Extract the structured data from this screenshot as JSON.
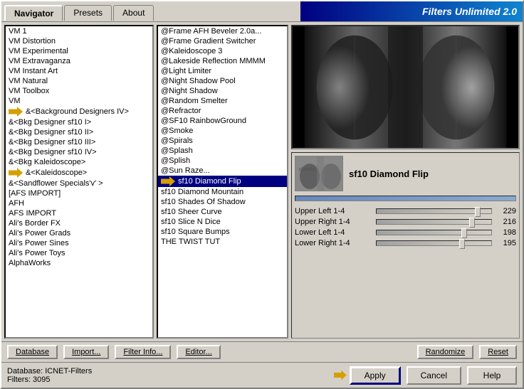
{
  "titleBar": {
    "title": "Filters Unlimited 2.0"
  },
  "tabs": [
    {
      "id": "navigator",
      "label": "Navigator",
      "active": true
    },
    {
      "id": "presets",
      "label": "Presets",
      "active": false
    },
    {
      "id": "about",
      "label": "About",
      "active": false
    }
  ],
  "leftList": {
    "items": [
      {
        "label": "VM 1",
        "selected": false,
        "hasArrow": false
      },
      {
        "label": "VM Distortion",
        "selected": false,
        "hasArrow": false
      },
      {
        "label": "VM Experimental",
        "selected": false,
        "hasArrow": false
      },
      {
        "label": "VM Extravaganza",
        "selected": false,
        "hasArrow": false
      },
      {
        "label": "VM Instant Art",
        "selected": false,
        "hasArrow": false
      },
      {
        "label": "VM Natural",
        "selected": false,
        "hasArrow": false
      },
      {
        "label": "VM Toolbox",
        "selected": false,
        "hasArrow": false
      },
      {
        "label": "VM",
        "selected": false,
        "hasArrow": false
      },
      {
        "label": "&<Background Designers IV>",
        "selected": false,
        "hasArrow": true
      },
      {
        "label": "&<Bkg Designer sf10 I>",
        "selected": false,
        "hasArrow": false
      },
      {
        "label": "&<Bkg Designer sf10 II>",
        "selected": false,
        "hasArrow": false
      },
      {
        "label": "&<Bkg Designer sf10 III>",
        "selected": false,
        "hasArrow": false
      },
      {
        "label": "&<Bkg Designer sf10 IV>",
        "selected": false,
        "hasArrow": false
      },
      {
        "label": "&<Bkg Kaleidoscope>",
        "selected": false,
        "hasArrow": false
      },
      {
        "label": "&<Kaleidoscope>",
        "selected": false,
        "hasArrow": true
      },
      {
        "label": "&<Sandflower Specials'v' >",
        "selected": false,
        "hasArrow": false
      },
      {
        "label": "[AFS IMPORT]",
        "selected": false,
        "hasArrow": false
      },
      {
        "label": "AFH",
        "selected": false,
        "hasArrow": false
      },
      {
        "label": "AFS IMPORT",
        "selected": false,
        "hasArrow": false
      },
      {
        "label": "Ali's Border FX",
        "selected": false,
        "hasArrow": false
      },
      {
        "label": "Ali's Power Grads",
        "selected": false,
        "hasArrow": false
      },
      {
        "label": "Ali's Power Sines",
        "selected": false,
        "hasArrow": false
      },
      {
        "label": "Ali's Power Toys",
        "selected": false,
        "hasArrow": false
      },
      {
        "label": "AlphaWorks",
        "selected": false,
        "hasArrow": false
      }
    ]
  },
  "filterList": {
    "items": [
      {
        "label": "@Frame AFH Beveler 2.0a...",
        "selected": false,
        "hasArrow": false
      },
      {
        "label": "@Frame Gradient Switcher",
        "selected": false,
        "hasArrow": false
      },
      {
        "label": "@Kaleidoscope 3",
        "selected": false,
        "hasArrow": false
      },
      {
        "label": "@Lakeside Reflection MMMM",
        "selected": false,
        "hasArrow": false
      },
      {
        "label": "@Light Limiter",
        "selected": false,
        "hasArrow": false
      },
      {
        "label": "@Night Shadow Pool",
        "selected": false,
        "hasArrow": false
      },
      {
        "label": "@Night Shadow",
        "selected": false,
        "hasArrow": false
      },
      {
        "label": "@Random Smelter",
        "selected": false,
        "hasArrow": false
      },
      {
        "label": "@Refractor",
        "selected": false,
        "hasArrow": false
      },
      {
        "label": "@SF10 RainbowGround",
        "selected": false,
        "hasArrow": false
      },
      {
        "label": "@Smoke",
        "selected": false,
        "hasArrow": false
      },
      {
        "label": "@Spirals",
        "selected": false,
        "hasArrow": false
      },
      {
        "label": "@Splash",
        "selected": false,
        "hasArrow": false
      },
      {
        "label": "@Splish",
        "selected": false,
        "hasArrow": false
      },
      {
        "label": "@Sun Raze...",
        "selected": false,
        "hasArrow": false
      },
      {
        "label": "sf10 Diamond Flip",
        "selected": true,
        "hasArrow": true
      },
      {
        "label": "sf10 Diamond Mountain",
        "selected": false,
        "hasArrow": false
      },
      {
        "label": "sf10 Shades Of Shadow",
        "selected": false,
        "hasArrow": false
      },
      {
        "label": "sf10 Sheer Curve",
        "selected": false,
        "hasArrow": false
      },
      {
        "label": "sf10 Slice N Dice",
        "selected": false,
        "hasArrow": false
      },
      {
        "label": "sf10 Square Bumps",
        "selected": false,
        "hasArrow": false
      },
      {
        "label": "THE TWIST TUT",
        "selected": false,
        "hasArrow": false
      }
    ]
  },
  "filterInfo": {
    "name": "sf10 Diamond Flip",
    "sliders": [
      {
        "label": "Upper Left 1-4",
        "value": 229,
        "percent": 90
      },
      {
        "label": "Upper Right 1-4",
        "value": 216,
        "percent": 85
      },
      {
        "label": "Lower Left 1-4",
        "value": 198,
        "percent": 78
      },
      {
        "label": "Lower Right 1-4",
        "value": 195,
        "percent": 76
      }
    ]
  },
  "toolbar": {
    "database": "Database",
    "import": "Import...",
    "filterInfo": "Filter Info...",
    "editor": "Editor...",
    "randomize": "Randomize",
    "reset": "Reset"
  },
  "statusBar": {
    "database": "Database: ICNET-Filters",
    "filters": "Filters: 3095"
  },
  "actions": {
    "apply": "Apply",
    "cancel": "Cancel",
    "help": "Help"
  }
}
